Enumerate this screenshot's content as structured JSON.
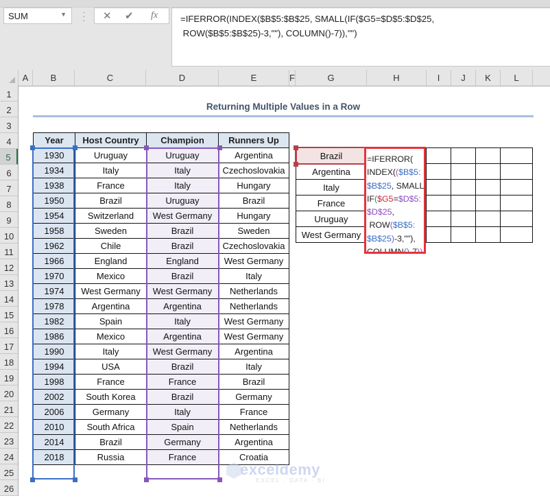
{
  "formula_bar": {
    "name_box": "SUM",
    "cancel_icon": "✕",
    "enter_icon": "✔",
    "fx_icon": "fx",
    "formula_line1": "=IFERROR(INDEX($B$5:$B$25, SMALL(IF($G5=$D$5:$D$25,",
    "formula_line2": " ROW($B$5:$B$25)-3,\"\"), COLUMN()-7)),\"\")"
  },
  "columns": [
    "A",
    "B",
    "C",
    "D",
    "E",
    "F",
    "G",
    "H",
    "I",
    "J",
    "K",
    "L"
  ],
  "rows": [
    "1",
    "2",
    "3",
    "4",
    "5",
    "6",
    "7",
    "8",
    "9",
    "10",
    "11",
    "12",
    "13",
    "14",
    "15",
    "16",
    "17",
    "18",
    "19",
    "20",
    "21",
    "22",
    "23",
    "24",
    "25",
    "26"
  ],
  "active_row": "5",
  "sheet": {
    "title": "Returning Multiple Values in a Row",
    "headers": [
      "Year",
      "Host Country",
      "Champion",
      "Runners Up"
    ],
    "records": [
      [
        "1930",
        "Uruguay",
        "Uruguay",
        "Argentina"
      ],
      [
        "1934",
        "Italy",
        "Italy",
        "Czechoslovakia"
      ],
      [
        "1938",
        "France",
        "Italy",
        "Hungary"
      ],
      [
        "1950",
        "Brazil",
        "Uruguay",
        "Brazil"
      ],
      [
        "1954",
        "Switzerland",
        "West Germany",
        "Hungary"
      ],
      [
        "1958",
        "Sweden",
        "Brazil",
        "Sweden"
      ],
      [
        "1962",
        "Chile",
        "Brazil",
        "Czechoslovakia"
      ],
      [
        "1966",
        "England",
        "England",
        "West Germany"
      ],
      [
        "1970",
        "Mexico",
        "Brazil",
        "Italy"
      ],
      [
        "1974",
        "West Germany",
        "West Germany",
        "Netherlands"
      ],
      [
        "1978",
        "Argentina",
        "Argentina",
        "Netherlands"
      ],
      [
        "1982",
        "Spain",
        "Italy",
        "West Germany"
      ],
      [
        "1986",
        "Mexico",
        "Argentina",
        "West Germany"
      ],
      [
        "1990",
        "Italy",
        "West Germany",
        "Argentina"
      ],
      [
        "1994",
        "USA",
        "Brazil",
        "Italy"
      ],
      [
        "1998",
        "France",
        "France",
        "Brazil"
      ],
      [
        "2002",
        "South Korea",
        "Brazil",
        "Germany"
      ],
      [
        "2006",
        "Germany",
        "Italy",
        "France"
      ],
      [
        "2010",
        "South Africa",
        "Spain",
        "Netherlands"
      ],
      [
        "2014",
        "Brazil",
        "Germany",
        "Argentina"
      ],
      [
        "2018",
        "Russia",
        "France",
        "Croatia"
      ]
    ],
    "lookup_champions": [
      "Brazil",
      "Argentina",
      "Italy",
      "France",
      "Uruguay",
      "West Germany"
    ],
    "editing_cell_formula": [
      [
        [
          "=IFERROR(",
          ""
        ]
      ],
      [
        [
          "INDEX(",
          ""
        ],
        [
          "(",
          "pink"
        ],
        [
          "$B$5:",
          "blue"
        ]
      ],
      [
        [
          "$B$25",
          "blue"
        ],
        [
          ", SMALL",
          ""
        ],
        [
          "(",
          "purple"
        ]
      ],
      [
        [
          "IF",
          ""
        ],
        [
          "(",
          "green"
        ],
        [
          "$G5",
          "red"
        ],
        [
          "=",
          ""
        ],
        [
          "$D$5:",
          "purple"
        ]
      ],
      [
        [
          "$D$25",
          "purple"
        ],
        [
          ",",
          ""
        ]
      ],
      [
        [
          " ROW",
          ""
        ],
        [
          "(",
          "purple"
        ],
        [
          "$B$5:",
          "blue"
        ]
      ],
      [
        [
          "$B$25",
          "blue"
        ],
        [
          ")",
          "purple"
        ],
        [
          "-3,\"\"),",
          ""
        ]
      ],
      [
        [
          "COLUMN",
          ""
        ],
        [
          "()",
          "blue"
        ],
        [
          "-7",
          ""
        ],
        [
          "))",
          "purple"
        ],
        [
          ",",
          ""
        ]
      ],
      [
        [
          "\"\")",
          ""
        ]
      ]
    ]
  },
  "watermark": {
    "brand": "exceldemy",
    "tagline": "EXCEL · DATA · BI"
  }
}
